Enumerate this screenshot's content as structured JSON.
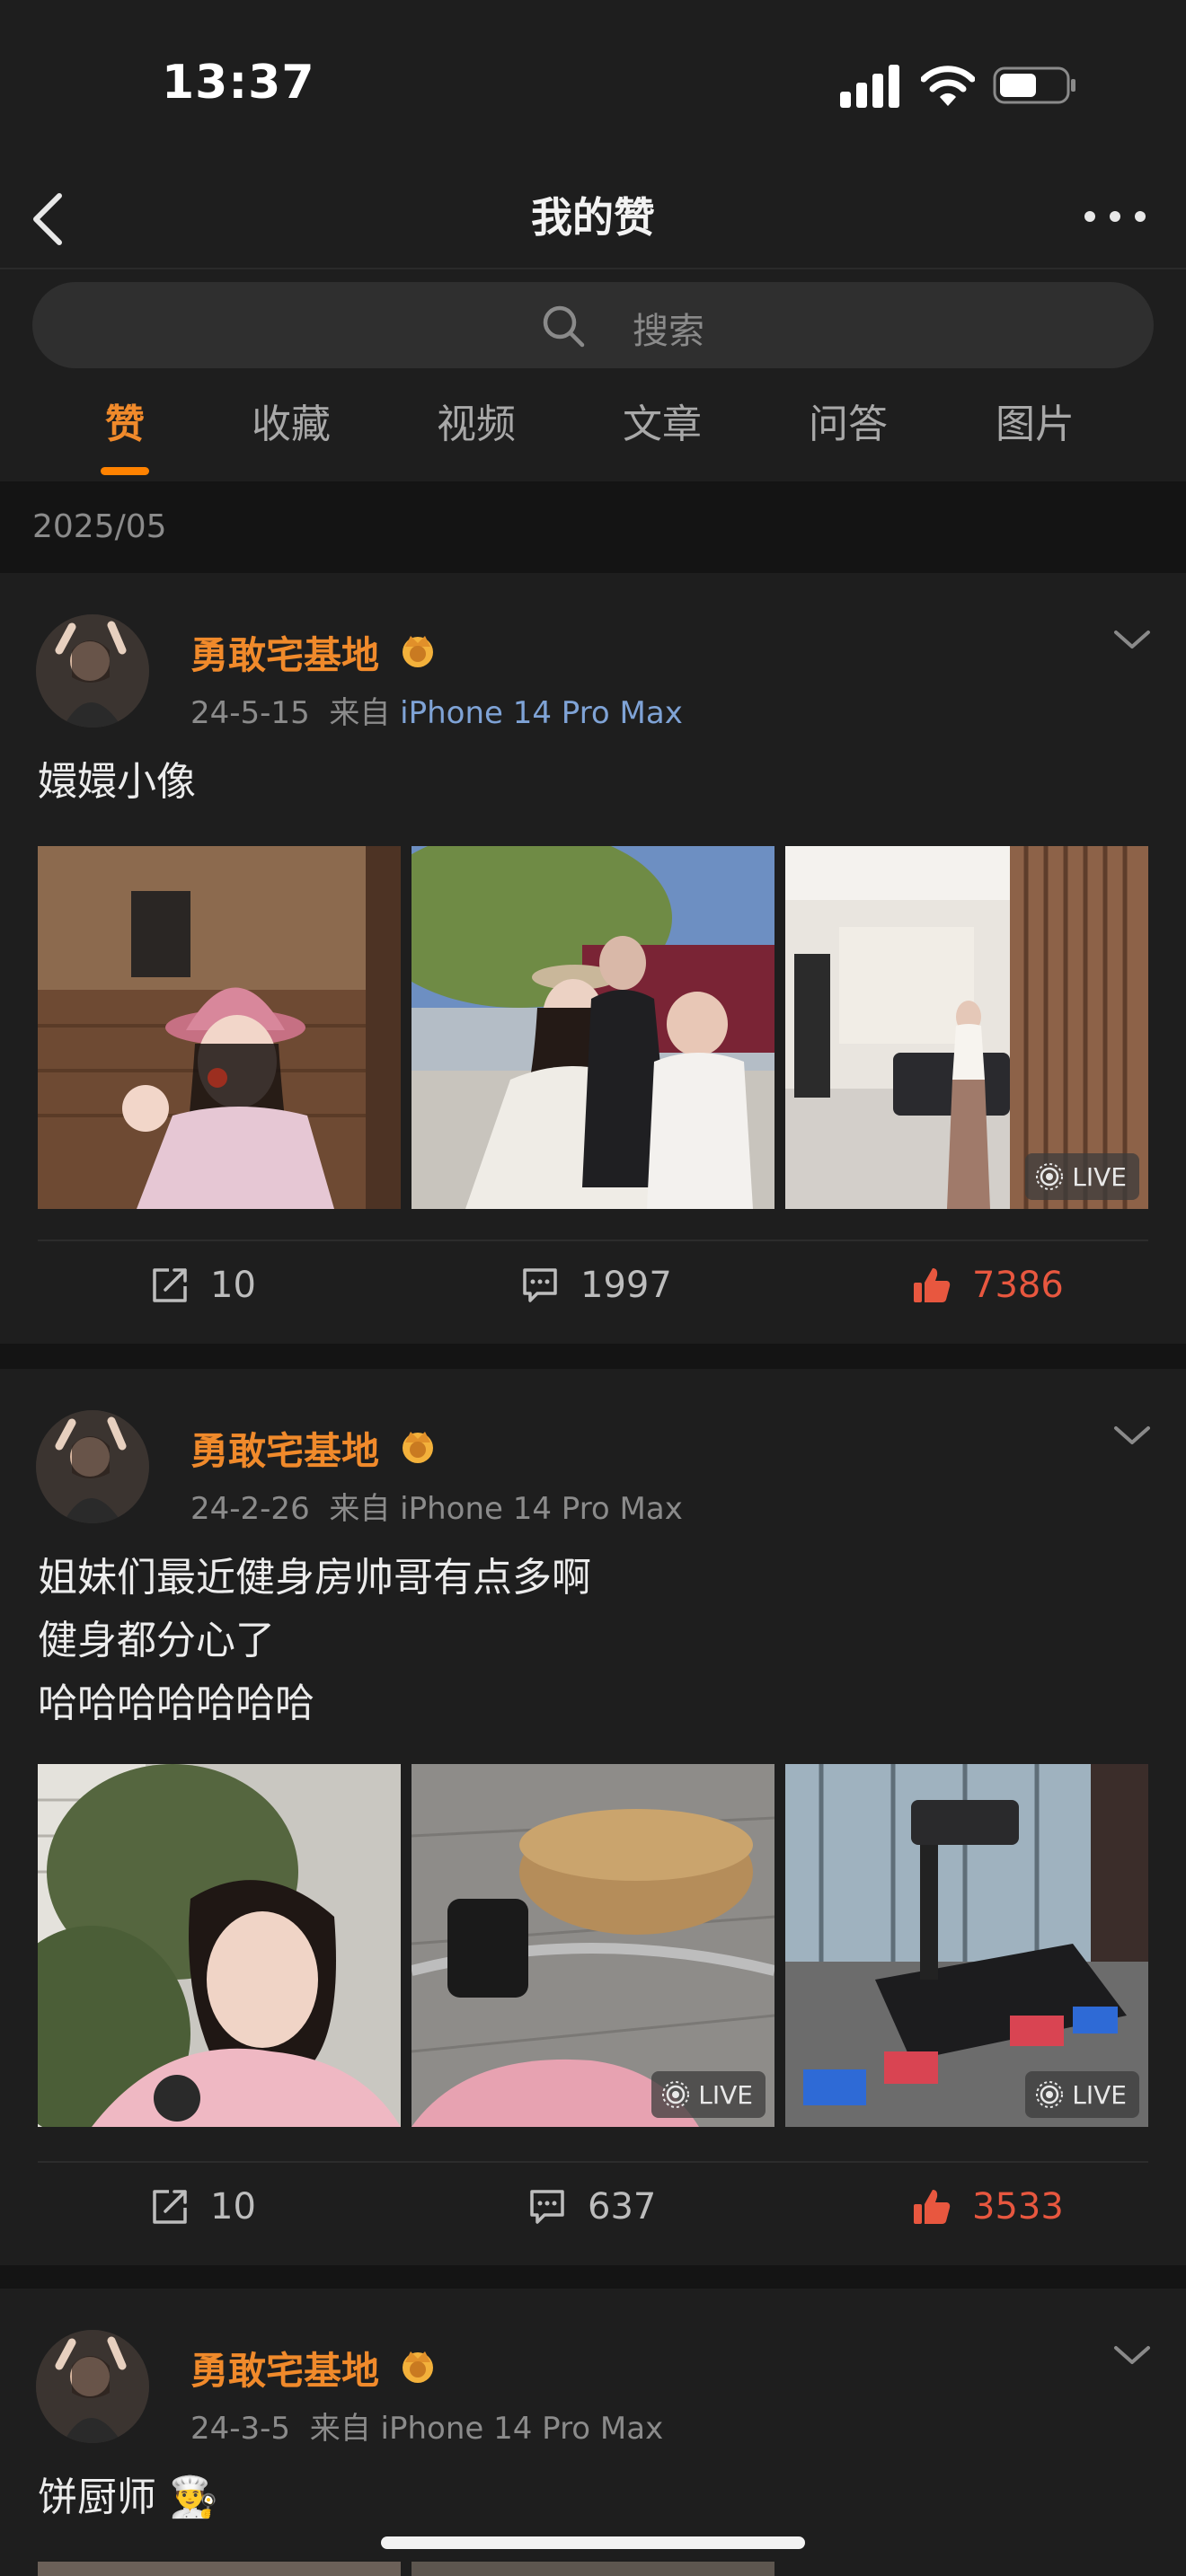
{
  "status_bar": {
    "time": "13:37"
  },
  "nav": {
    "title": "我的赞"
  },
  "search": {
    "placeholder": "搜索"
  },
  "tabs": [
    {
      "label": "赞",
      "active": true
    },
    {
      "label": "收藏",
      "active": false
    },
    {
      "label": "视频",
      "active": false
    },
    {
      "label": "文章",
      "active": false
    },
    {
      "label": "问答",
      "active": false
    },
    {
      "label": "图片",
      "active": false
    }
  ],
  "month": "2025/05",
  "posts": [
    {
      "username": "勇敢宅基地",
      "date": "24-5-15",
      "source_prefix": "来自",
      "device": "iPhone 14 Pro Max",
      "text_lines": [
        "嬛嬛小像"
      ],
      "images": [
        {
          "subject": "girl-in-pink-hat",
          "live": false
        },
        {
          "subject": "family-outdoors",
          "live": false
        },
        {
          "subject": "mirror-selfie-room",
          "live": true
        }
      ],
      "live_label": "LIVE",
      "reposts": "10",
      "comments": "1997",
      "likes": "7386"
    },
    {
      "username": "勇敢宅基地",
      "date": "24-2-26",
      "source_prefix": "来自",
      "device": "iPhone 14 Pro Max",
      "text_lines": [
        "姐妹们最近健身房帅哥有点多啊",
        "健身都分心了",
        "哈哈哈哈哈哈哈"
      ],
      "images": [
        {
          "subject": "girl-pink-jacket",
          "live": false
        },
        {
          "subject": "bicycle-basket",
          "live": true
        },
        {
          "subject": "treadmill-gym",
          "live": true
        }
      ],
      "live_label": "LIVE",
      "reposts": "10",
      "comments": "637",
      "likes": "3533"
    },
    {
      "username": "勇敢宅基地",
      "date": "24-3-5",
      "source_prefix": "来自",
      "device": "iPhone 14 Pro Max",
      "text_lines": [
        "饼厨师 👨‍🍳"
      ]
    }
  ],
  "colors": {
    "accent": "#ff8200",
    "username": "#f08a2b",
    "like": "#e8573f",
    "background": "#1e1e1e"
  }
}
